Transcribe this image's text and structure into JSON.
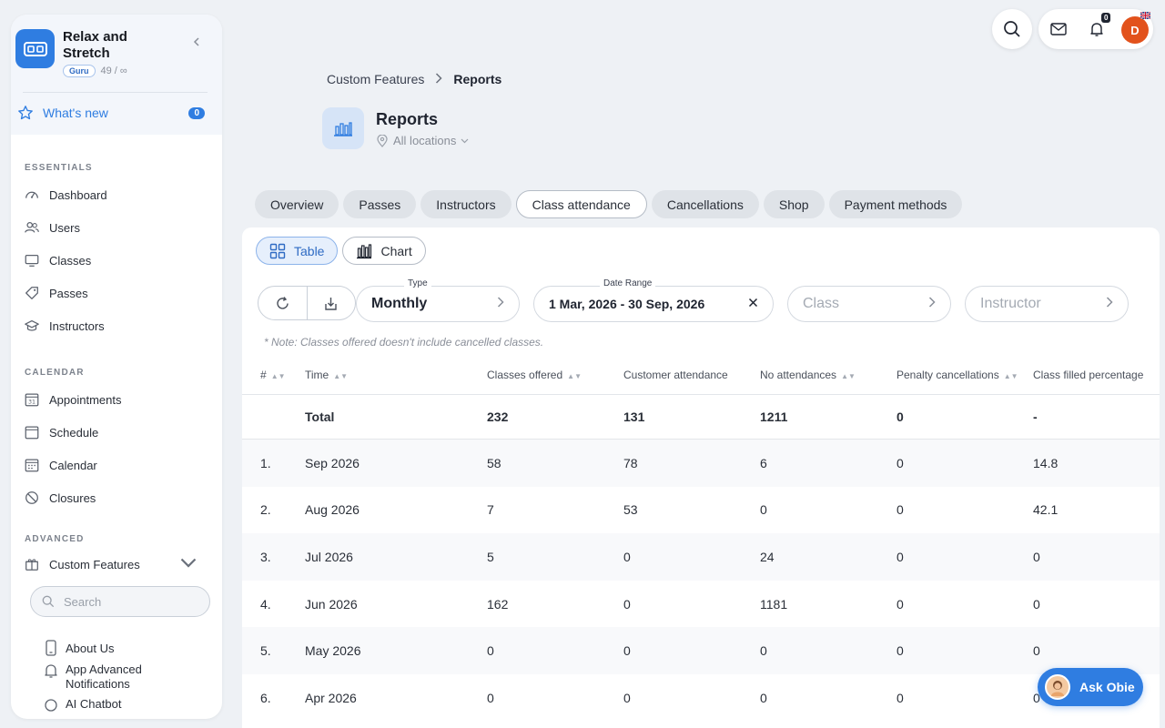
{
  "sidebar": {
    "brand_name": "Relax and Stretch",
    "plan_badge": "Guru",
    "usage": "49 / ∞",
    "whats_new": {
      "label": "What's new",
      "count": "0"
    },
    "sections": {
      "essentials": "ESSENTIALS",
      "calendar": "CALENDAR",
      "advanced": "ADVANCED"
    },
    "essentials_items": [
      "Dashboard",
      "Users",
      "Classes",
      "Passes",
      "Instructors"
    ],
    "calendar_items": [
      "Appointments",
      "Schedule",
      "Calendar",
      "Closures"
    ],
    "custom_features": "Custom Features",
    "search_placeholder": "Search",
    "sub_items": [
      "About Us",
      "App Advanced Notifications",
      "AI Chatbot"
    ]
  },
  "topbar": {
    "notification_count": "0",
    "avatar_initial": "D"
  },
  "header": {
    "breadcrumb": [
      "Custom Features",
      "Reports"
    ],
    "title": "Reports",
    "location": "All locations"
  },
  "tabs": [
    "Overview",
    "Passes",
    "Instructors",
    "Class attendance",
    "Cancellations",
    "Shop",
    "Payment methods"
  ],
  "active_tab": "Class attendance",
  "view_toggle": {
    "table": "Table",
    "chart": "Chart",
    "active": "Table"
  },
  "filters": {
    "type_label": "Type",
    "type_value": "Monthly",
    "date_label": "Date Range",
    "date_value": "1 Mar, 2026 - 30 Sep, 2026",
    "class_placeholder": "Class",
    "instructor_placeholder": "Instructor"
  },
  "note": "* Note: Classes offered doesn't include cancelled classes.",
  "table": {
    "columns": [
      "#",
      "Time",
      "Classes offered",
      "Customer attendance",
      "No attendances",
      "Penalty cancellations",
      "Class filled percentage"
    ],
    "total": [
      "",
      "Total",
      "232",
      "131",
      "1211",
      "0",
      "-"
    ],
    "rows": [
      [
        "1.",
        "Sep 2026",
        "58",
        "78",
        "6",
        "0",
        "14.8"
      ],
      [
        "2.",
        "Aug 2026",
        "7",
        "53",
        "0",
        "0",
        "42.1"
      ],
      [
        "3.",
        "Jul 2026",
        "5",
        "0",
        "24",
        "0",
        "0"
      ],
      [
        "4.",
        "Jun 2026",
        "162",
        "0",
        "1181",
        "0",
        "0"
      ],
      [
        "5.",
        "May 2026",
        "0",
        "0",
        "0",
        "0",
        "0"
      ],
      [
        "6.",
        "Apr 2026",
        "0",
        "0",
        "0",
        "0",
        "0"
      ]
    ]
  },
  "ask_obie": "Ask Obie",
  "colors": {
    "accent": "#2f7de1",
    "avatar": "#e2521c"
  }
}
